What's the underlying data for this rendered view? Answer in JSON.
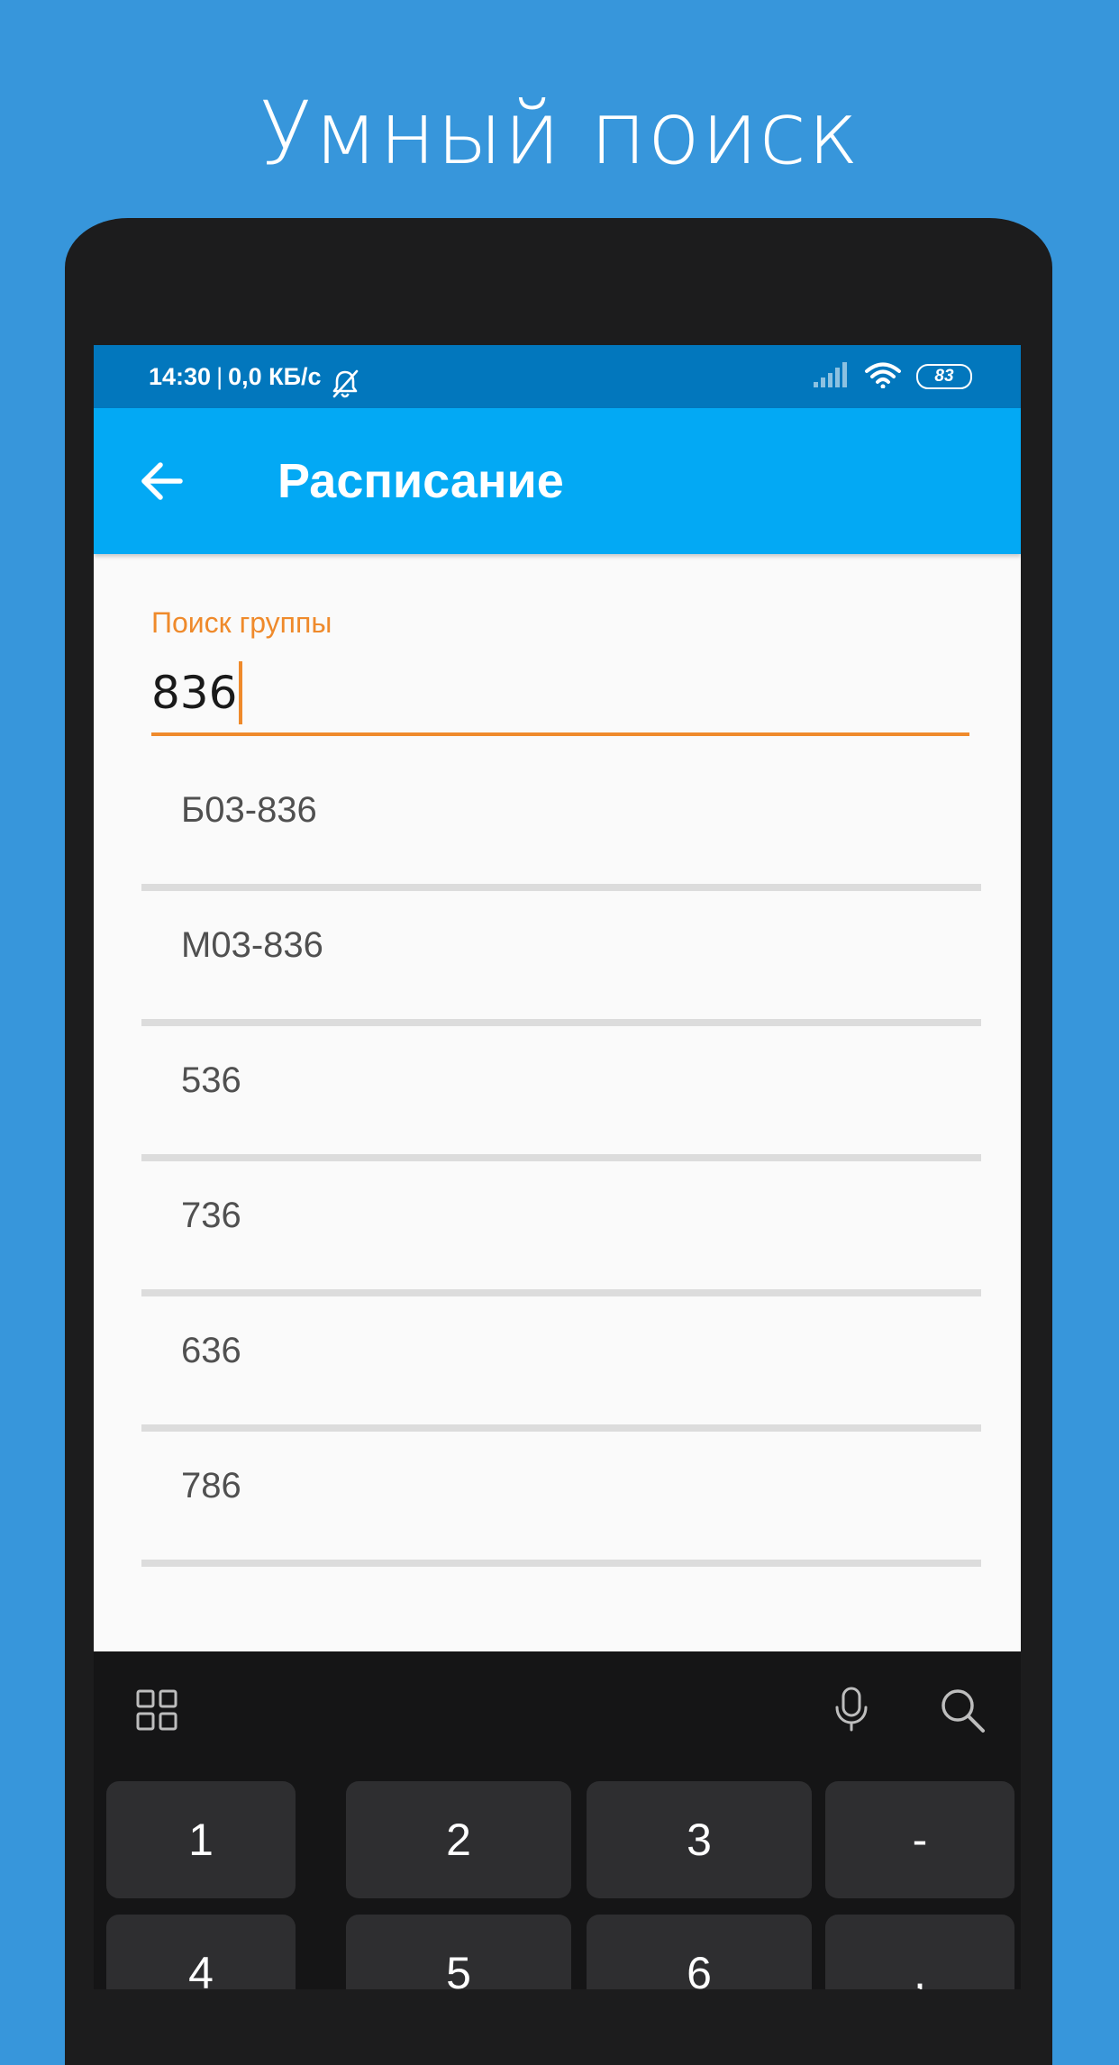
{
  "promo": {
    "title": "Умный поиск"
  },
  "status_bar": {
    "time": "14:30",
    "separator": "|",
    "speed": "0,0 КБ/с",
    "battery": "83"
  },
  "app_bar": {
    "title": "Расписание"
  },
  "search": {
    "label": "Поиск группы",
    "value": "836"
  },
  "suggestions": [
    "Б03-836",
    "М03-836",
    "536",
    "736",
    "636",
    "786"
  ],
  "keyboard": {
    "row1": [
      "1",
      "2",
      "3",
      "-"
    ],
    "row2": [
      "4",
      "5",
      "6",
      ","
    ]
  },
  "colors": {
    "background": "#3796DB",
    "status_bar": "#0277BD",
    "app_bar": "#03A9F4",
    "accent": "#EF8A2B",
    "keyboard": "#151516",
    "key": "#2E2E30"
  }
}
